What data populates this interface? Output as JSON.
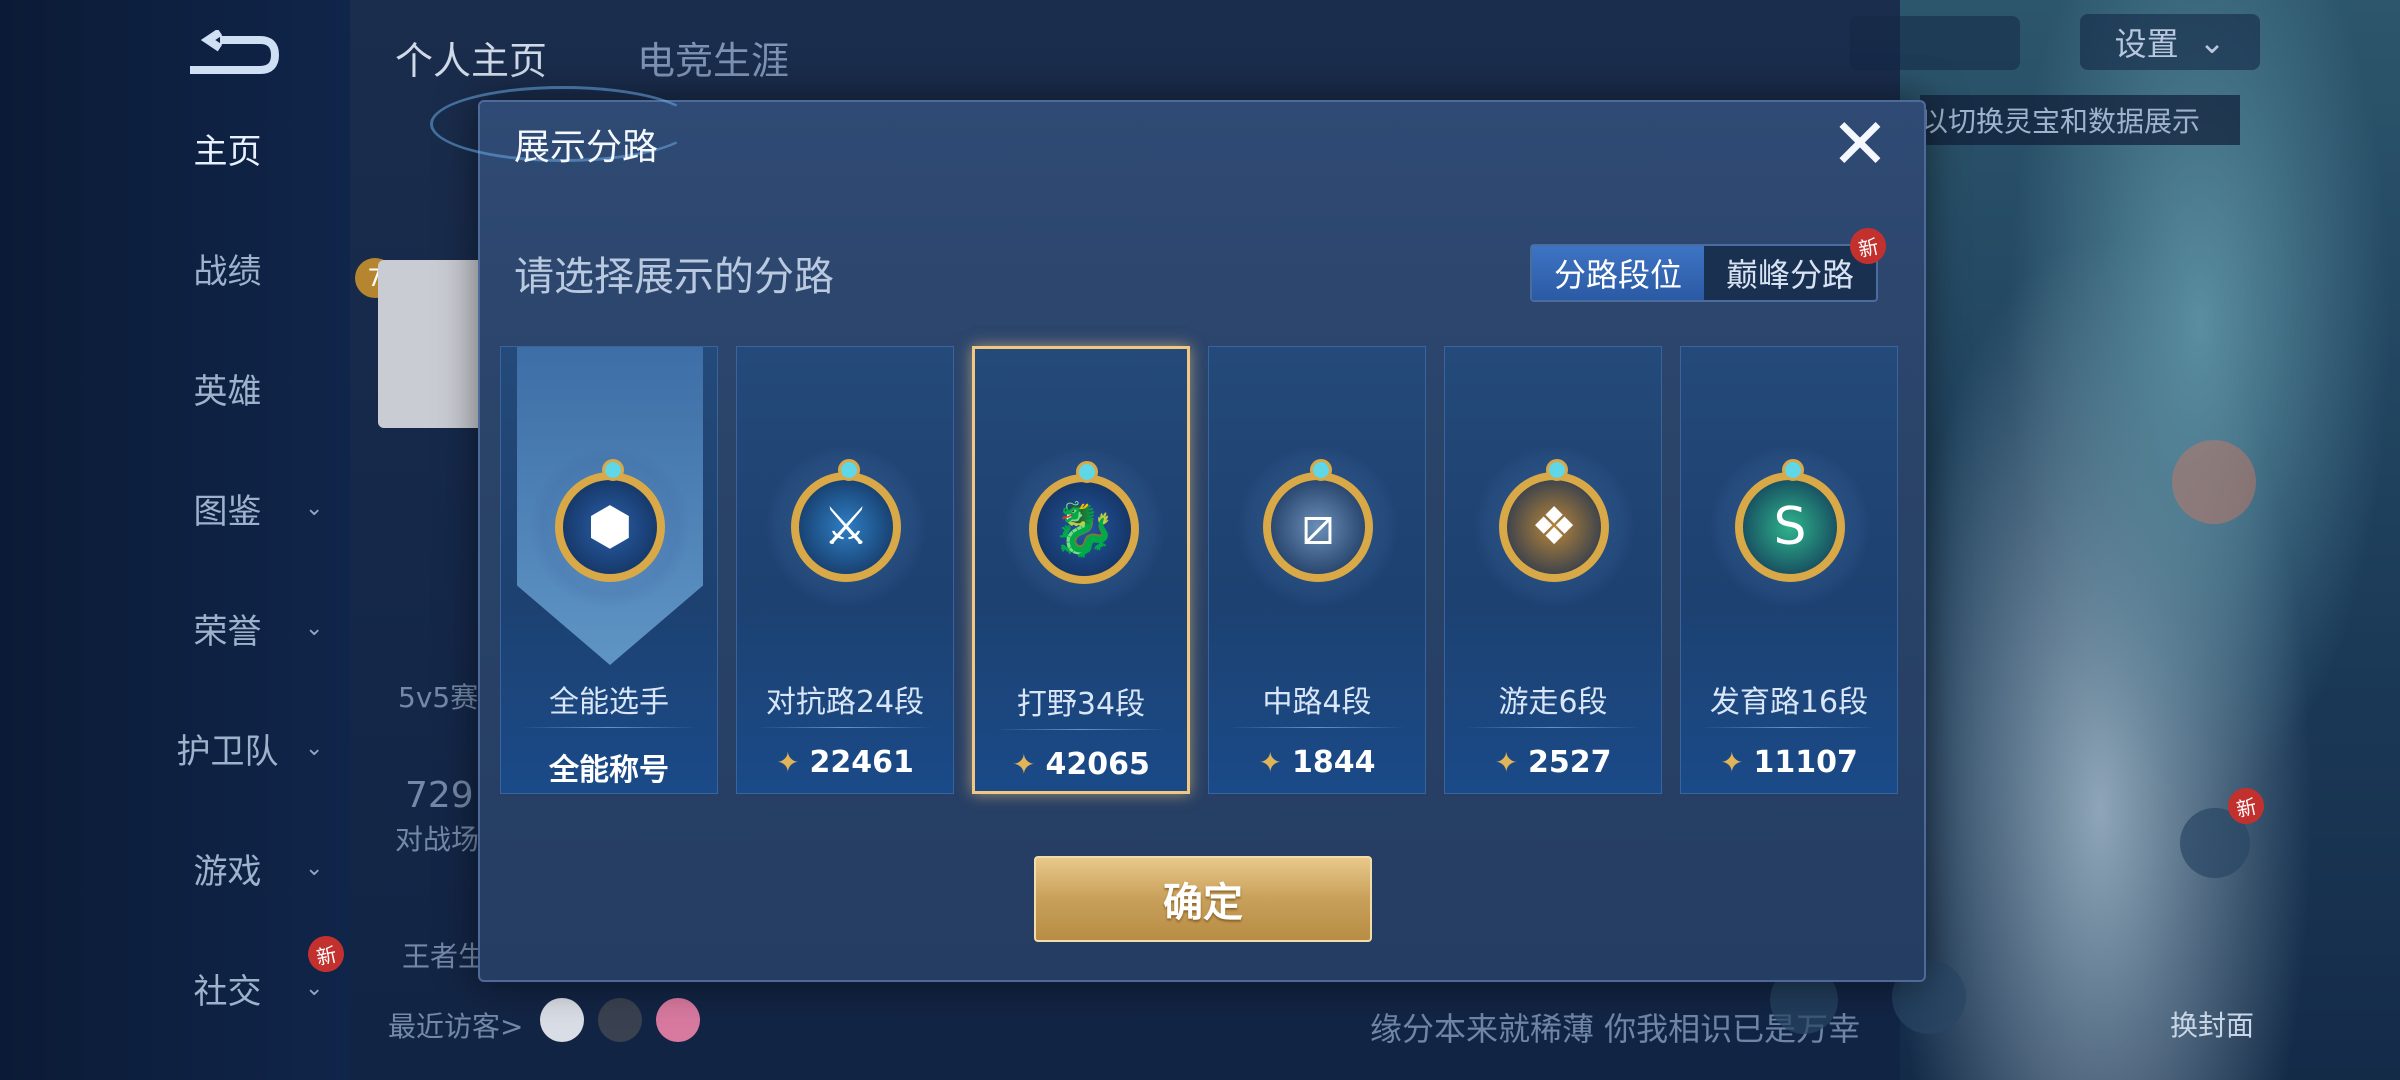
{
  "background": {
    "nav": [
      {
        "label": "主页",
        "active": true,
        "chevron": false
      },
      {
        "label": "战绩",
        "chevron": false
      },
      {
        "label": "英雄",
        "chevron": false
      },
      {
        "label": "图鉴",
        "chevron": true
      },
      {
        "label": "荣誉",
        "chevron": true
      },
      {
        "label": "护卫队",
        "chevron": true
      },
      {
        "label": "游戏",
        "chevron": true
      },
      {
        "label": "社交",
        "chevron": true,
        "badge": "新"
      }
    ],
    "tabs": [
      "个人主页",
      "电竞生涯"
    ],
    "settings_label": "设置",
    "hint_text": "以切换灵宝和数据展示",
    "mode_text": "5v5赛",
    "stat_number": "729",
    "stat_label": "对战场",
    "wang_text": "王者生",
    "recent_visitors": "最近访客>",
    "bottom_quote": "缘分本来就稀薄 你我相识已是万幸",
    "change_cover": "换封面",
    "right_badge": "新",
    "level": "7"
  },
  "dialog": {
    "title": "展示分路",
    "subtitle": "请选择展示的分路",
    "close_glyph": "✕",
    "toggle": {
      "options": [
        "分路段位",
        "巅峰分路"
      ],
      "selected": "分路段位",
      "new_badge": "新"
    },
    "confirm_label": "确定",
    "cards": [
      {
        "role": "全能选手",
        "value": "全能称号",
        "icon": "all-round-emblem-icon",
        "glyph": "⬢",
        "color": "#2a5fa8",
        "selected": false,
        "special": true
      },
      {
        "role": "对抗路24段",
        "value": "22461",
        "icon": "clash-lane-emblem-icon",
        "glyph": "⚔",
        "color": "#2f7ec4",
        "selected": false
      },
      {
        "role": "打野34段",
        "value": "42065",
        "icon": "jungle-emblem-icon",
        "glyph": "🐉",
        "color": "#2556a0",
        "selected": true
      },
      {
        "role": "中路4段",
        "value": "1844",
        "icon": "mid-lane-emblem-icon",
        "glyph": "⧄",
        "color": "#6b8fb8",
        "selected": false
      },
      {
        "role": "游走6段",
        "value": "2527",
        "icon": "roam-emblem-icon",
        "glyph": "❖",
        "color": "#b8863a",
        "selected": false
      },
      {
        "role": "发育路16段",
        "value": "11107",
        "icon": "farm-lane-emblem-icon",
        "glyph": "S",
        "color": "#2fb58c",
        "selected": false
      }
    ],
    "score_crest_glyph": "✦"
  }
}
